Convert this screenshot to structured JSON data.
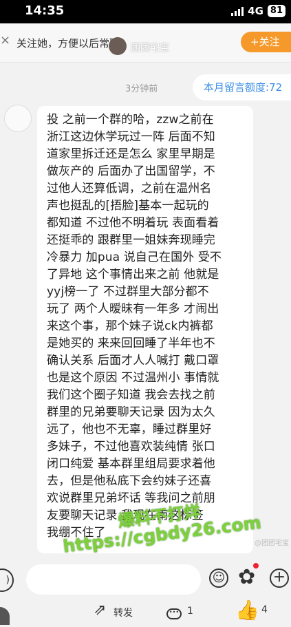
{
  "status_bar": {
    "time": "14:35",
    "network": "4G",
    "battery": "81"
  },
  "follow_notice": {
    "text": "关注她，方便以后常聊",
    "name": "团团宅宝",
    "follow_label": "+关注",
    "close_glyph": "×"
  },
  "chat": {
    "timestamp": "3分钟前",
    "quota_label": "本月留言额度:72",
    "message_lines": [
      "投 之前一个群的哈，zzw之前在",
      "浙江这边休学玩过一阵 后面不知",
      "道家里拆迁还是怎么 家里早期是",
      "做灰产的 后面办了出国留学，不",
      "过他人还算低调，之前在温州名",
      "声也挺乱的[捂脸]基本一起玩的",
      "都知道 不过他不明着玩 表面看着",
      "还挺乖的 跟群里一姐妹奔现睡完",
      "冷暴力 加pua 说自己在国外 受不",
      "了异地 这个事情出来之前 他就是",
      "yyj榜一了 不过群里大部分都不",
      "玩了 两个人暧昧有一年多 才闹出",
      "来这个事，那个妹子说ck内裤都",
      "是她买的 来来回回睡了半年也不",
      "确认关系 后面才人人喊打 戴口罩",
      "也是这个原因 不过温州小 事情就",
      "我们这个圈子知道 我会去找之前",
      "群里的兄弟要聊天记录 因为太久",
      "远了，他也不无辜，睡过群里好",
      "多妹子，不过他喜欢装纯情 张口",
      "闭口纯爱 基本群里组局要求着他",
      "去，但是他私底下会约妹子还喜",
      "欢说群里兄弟坏话 等我问之前朋",
      "友要聊天记录 我现在南这标签",
      "我绷不住了"
    ]
  },
  "watermark": {
    "line1": "爆料不打烊",
    "line2": "https://cgbdy26.com",
    "stamp": "@团团宅宝"
  },
  "bottom_bar": {
    "share_label": "转发",
    "comment_count": "1",
    "like_count": "4"
  },
  "colors": {
    "accent_orange": "#f59a2a",
    "link_blue": "#3a8ee6",
    "watermark_green": "#7dd13a"
  },
  "icons": [
    "voice-icon",
    "emoji-icon",
    "gift-icon",
    "plus-icon",
    "share-icon",
    "comment-icon",
    "like-icon",
    "close-icon"
  ]
}
